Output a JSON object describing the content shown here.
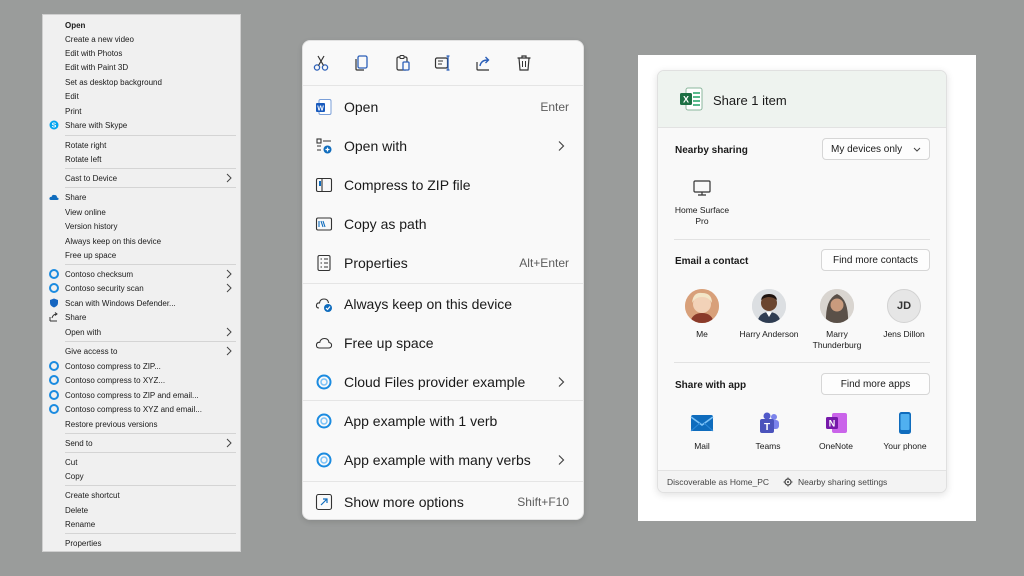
{
  "classic_menu": {
    "items": [
      {
        "label": "Open"
      },
      {
        "label": "Create a new video"
      },
      {
        "label": "Edit with Photos"
      },
      {
        "label": "Edit with Paint 3D"
      },
      {
        "label": "Set as desktop background"
      },
      {
        "label": "Edit"
      },
      {
        "label": "Print"
      },
      {
        "label": "Share with Skype"
      },
      {
        "label": "Rotate right"
      },
      {
        "label": "Rotate left"
      },
      {
        "label": "Cast to Device"
      },
      {
        "label": "Share"
      },
      {
        "label": "View online"
      },
      {
        "label": "Version history"
      },
      {
        "label": "Always keep on this device"
      },
      {
        "label": "Free up space"
      },
      {
        "label": "Contoso checksum"
      },
      {
        "label": "Contoso security scan"
      },
      {
        "label": "Scan with Windows Defender..."
      },
      {
        "label": "Share"
      },
      {
        "label": "Open with"
      },
      {
        "label": "Give access to"
      },
      {
        "label": "Contoso compress to ZIP..."
      },
      {
        "label": "Contoso compress to XYZ..."
      },
      {
        "label": "Contoso compress to ZIP and email..."
      },
      {
        "label": "Contoso compress to XYZ and email..."
      },
      {
        "label": "Restore previous versions"
      },
      {
        "label": "Send to"
      },
      {
        "label": "Cut"
      },
      {
        "label": "Copy"
      },
      {
        "label": "Create shortcut"
      },
      {
        "label": "Delete"
      },
      {
        "label": "Rename"
      },
      {
        "label": "Properties"
      }
    ]
  },
  "modern_menu": {
    "toolbar": [
      {
        "icon": "cut-icon"
      },
      {
        "icon": "copy-icon"
      },
      {
        "icon": "paste-icon"
      },
      {
        "icon": "rename-icon"
      },
      {
        "icon": "share-icon"
      },
      {
        "icon": "delete-icon"
      }
    ],
    "items": [
      {
        "label": "Open",
        "shortcut": "Enter"
      },
      {
        "label": "Open with"
      },
      {
        "label": "Compress to ZIP file"
      },
      {
        "label": "Copy as path"
      },
      {
        "label": "Properties",
        "shortcut": "Alt+Enter"
      },
      {
        "label": "Always keep on this device"
      },
      {
        "label": "Free up space"
      },
      {
        "label": "Cloud Files provider example"
      },
      {
        "label": "App example with 1 verb"
      },
      {
        "label": "App example with many verbs"
      },
      {
        "label": "Show more options",
        "shortcut": "Shift+F10"
      }
    ]
  },
  "share_panel": {
    "title": "Share 1 item",
    "nearby": {
      "title": "Nearby sharing",
      "dropdown_value": "My devices only",
      "device_line1": "Home Surface",
      "device_line2": "Pro"
    },
    "email": {
      "title": "Email a contact",
      "button": "Find more contacts",
      "contacts": [
        {
          "line1": "Me",
          "line2": ""
        },
        {
          "line1": "Harry Anderson",
          "line2": ""
        },
        {
          "line1": "Marry",
          "line2": "Thunderburg"
        },
        {
          "line1": "Jens Dillon",
          "line2": "",
          "initials": "JD"
        }
      ]
    },
    "apps": {
      "title": "Share with app",
      "button": "Find more apps",
      "items": [
        {
          "label": "Mail"
        },
        {
          "label": "Teams"
        },
        {
          "label": "OneNote"
        },
        {
          "label": "Your phone"
        }
      ]
    },
    "footer": {
      "discoverable": "Discoverable as Home_PC",
      "settings": "Nearby sharing settings"
    }
  },
  "colors": {
    "classic_bg": "#f0f0f0",
    "modern_bg": "#f9f9f9",
    "accent_blue": "#0067c0",
    "excel_green": "#1d7044"
  }
}
